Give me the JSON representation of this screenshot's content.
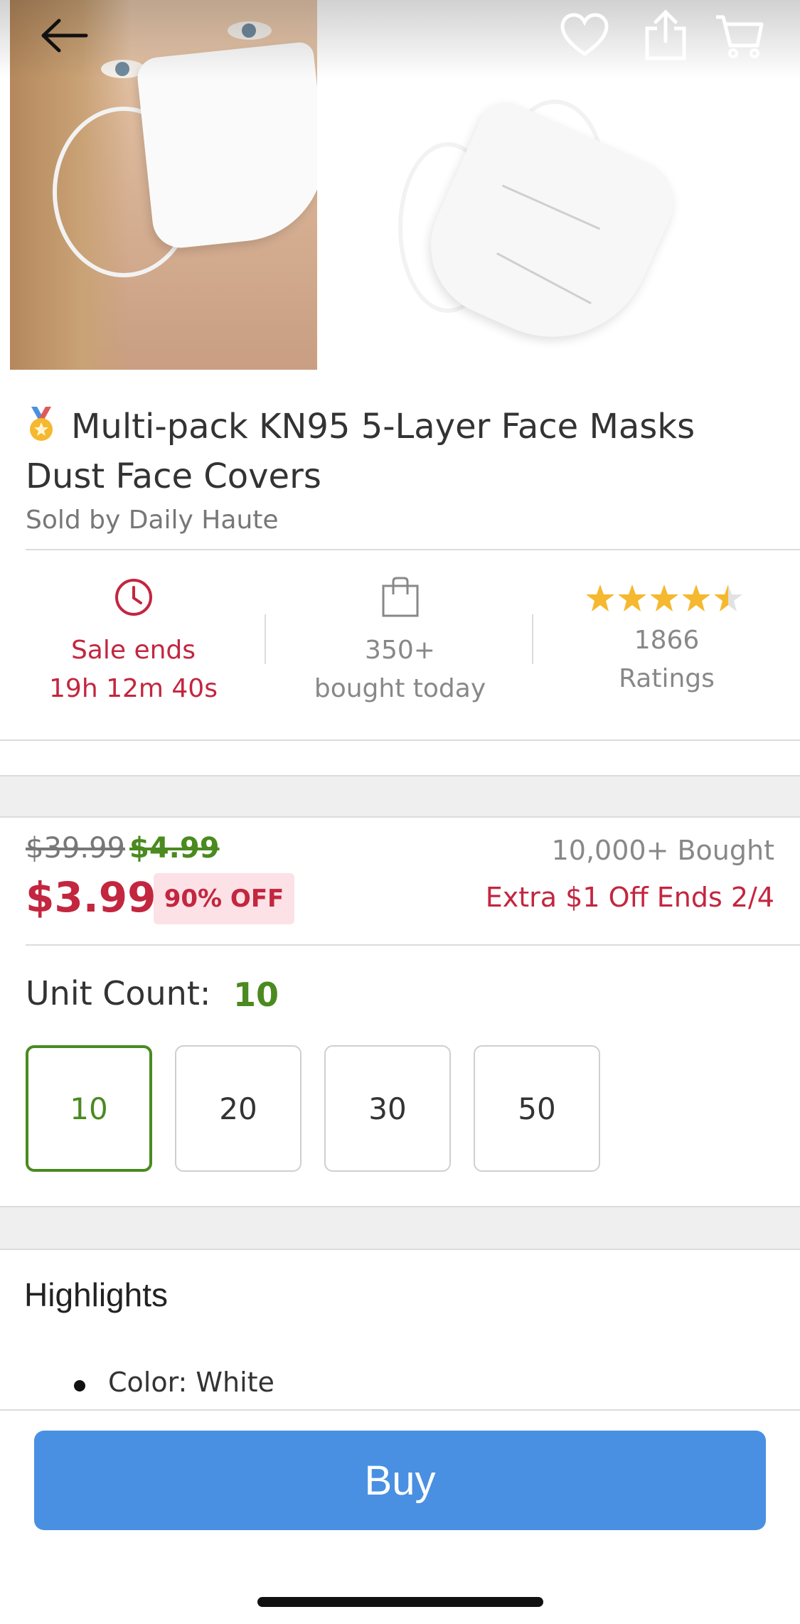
{
  "header": {
    "back_icon": "arrow-left-icon",
    "wishlist_icon": "heart-icon",
    "share_icon": "share-icon",
    "cart_icon": "cart-icon"
  },
  "product": {
    "title": "Multi-pack KN95 5-Layer Face Masks Dust Face Covers",
    "badge_icon": "medal-icon",
    "seller": "Sold by Daily Haute"
  },
  "stats": {
    "sale": {
      "icon": "clock-icon",
      "line1": "Sale ends",
      "line2": "19h 12m 40s"
    },
    "bought": {
      "icon": "shopping-bag-icon",
      "line1": "350+",
      "line2": "bought today"
    },
    "rating": {
      "stars": 4.5,
      "count": "1866",
      "label": "Ratings"
    }
  },
  "price": {
    "original": "$39.99",
    "previous": "$4.99",
    "current": "$3.99",
    "discount": "90% OFF",
    "bought_count": "10,000+ Bought",
    "extra_offer": "Extra $1 Off Ends 2/4"
  },
  "unit_count": {
    "label": "Unit Count:",
    "selected": "10",
    "options": [
      "10",
      "20",
      "30",
      "50"
    ]
  },
  "highlights": {
    "title": "Highlights",
    "items": [
      "Color: White"
    ]
  },
  "actions": {
    "buy_label": "Buy"
  },
  "colors": {
    "accent_red": "#c3263f",
    "accent_green": "#4a8a1f",
    "buy_blue": "#4a90e2",
    "star_gold": "#f5b82e"
  }
}
